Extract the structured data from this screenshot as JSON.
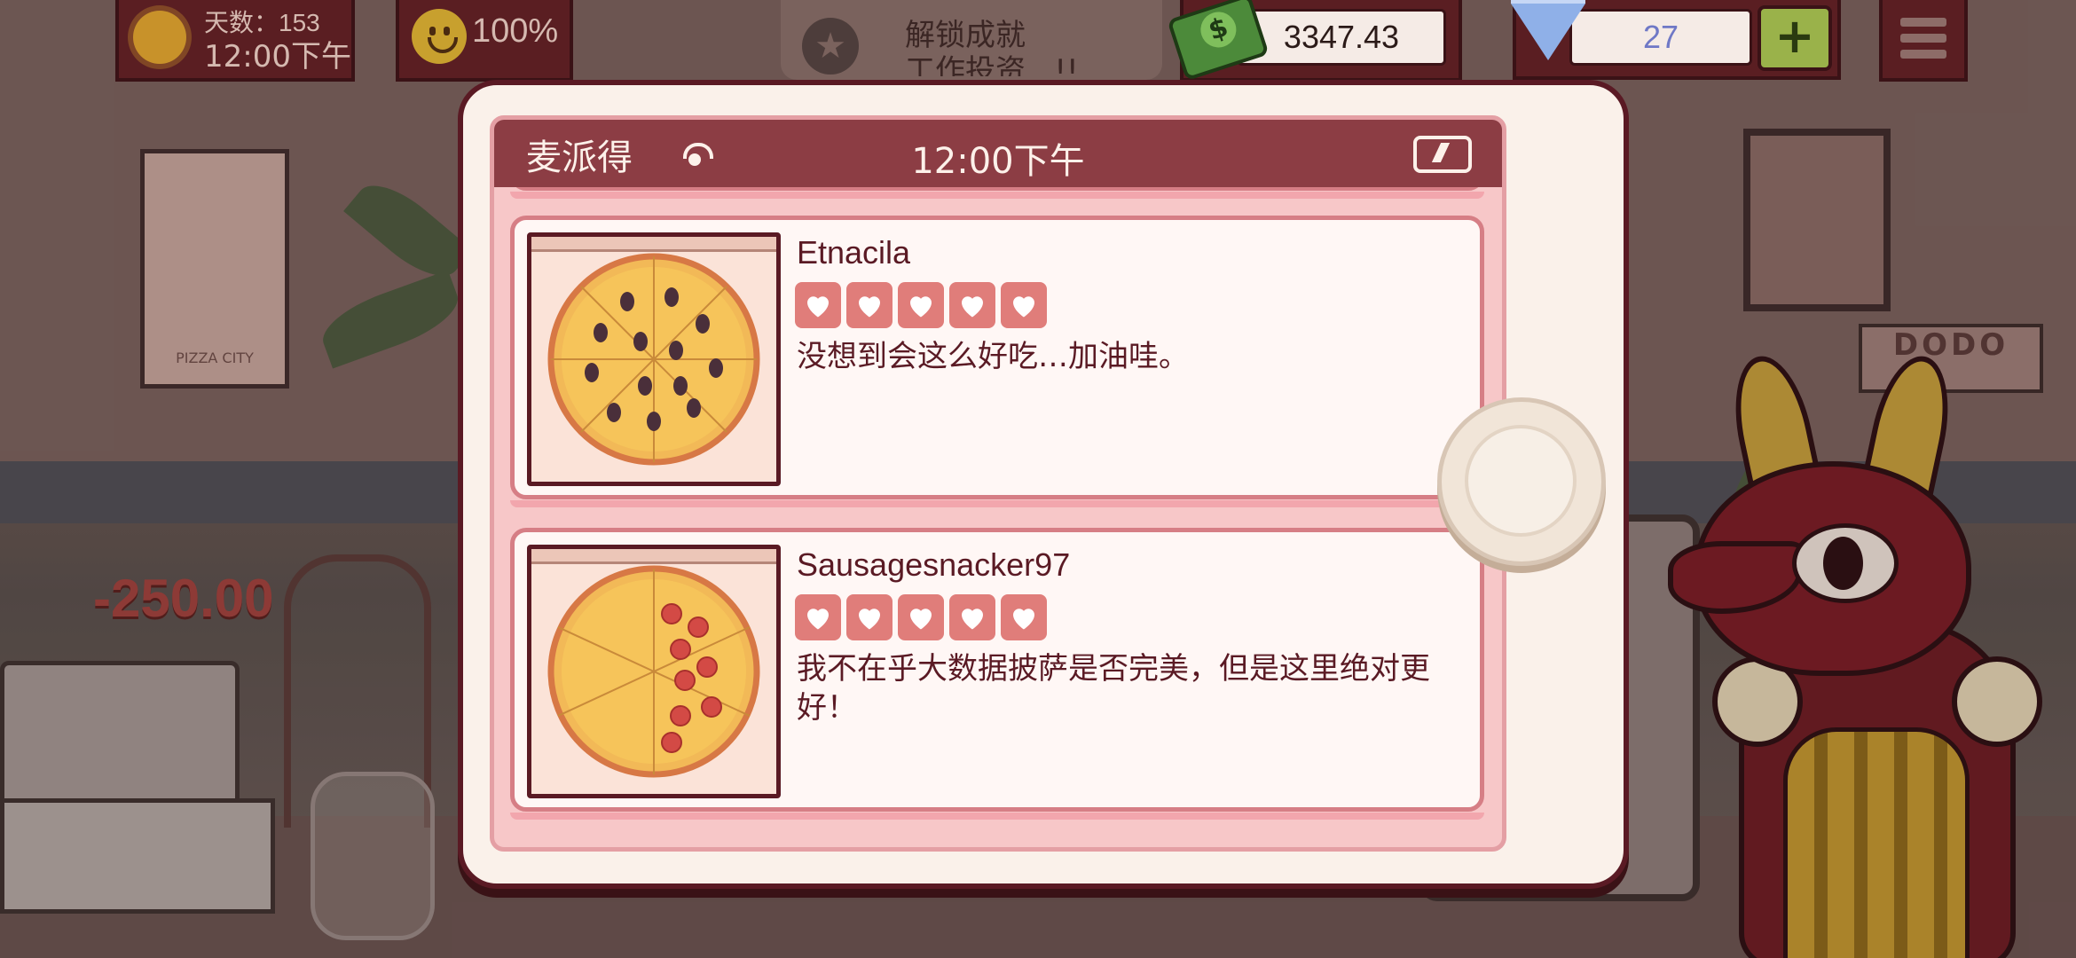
{
  "hud": {
    "day_label": "天数：",
    "day_number": "153",
    "time": "12:00下午",
    "happiness": "100%",
    "unlock_line1": "解锁成就",
    "unlock_line2": "工作投资...!!",
    "money": "3347.43",
    "gems": "27",
    "plus_label": "+"
  },
  "background": {
    "deduction": "-250.00",
    "poster_text": "PIZZA CITY",
    "sign_text": "DODO"
  },
  "phone": {
    "app_name": "麦派得",
    "time": "12:00下午",
    "reviews": [
      {
        "name": "Etnacila",
        "hearts": 5,
        "comment": "没想到会这么好吃…加油哇。",
        "pizza": "mushroom"
      },
      {
        "name": "Sausagesnacker97",
        "hearts": 5,
        "comment": "我不在乎大数据披萨是否完美，但是这里绝对更好！",
        "pizza": "pepperoni"
      }
    ]
  },
  "colors": {
    "status_bar": "#8c3d44",
    "heart_bg": "#e07d7a",
    "text_dark": "#5a1a24"
  }
}
